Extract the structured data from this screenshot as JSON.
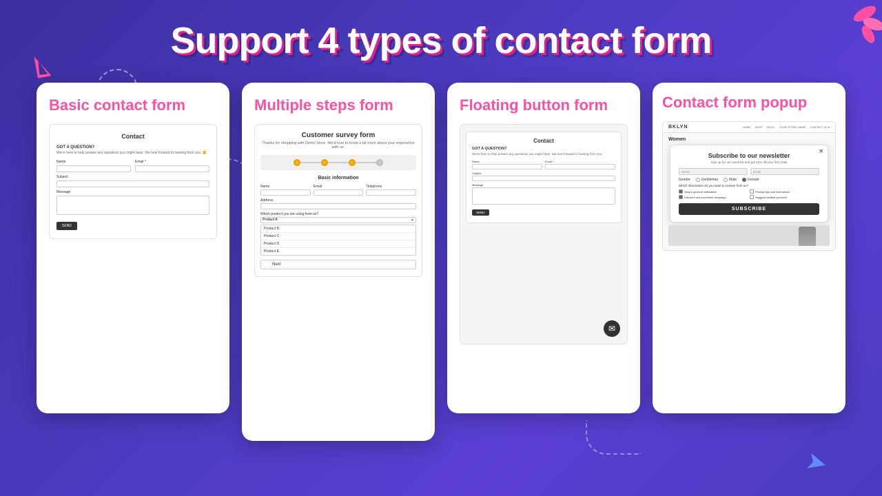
{
  "page": {
    "title": "Support 4 types of contact form",
    "background_gradient": "#3b2fa0"
  },
  "cards": [
    {
      "id": "basic",
      "title": "Basic contact form",
      "preview": {
        "heading": "Contact",
        "section_label": "GOT A QUESTION?",
        "section_text": "We're here to help answer any questions you might have. We look forward to hearing from you. 😊",
        "fields": [
          "Name",
          "Email *",
          "Subject",
          "Message"
        ],
        "button": "SEND"
      }
    },
    {
      "id": "multistep",
      "title": "Multiple steps form",
      "preview": {
        "heading": "Customer survey form",
        "subheading": "Thanks for shopping with Demo Store. We'd love to know a bit more about your experience with us.",
        "progress_steps": 4,
        "section": "Basic information",
        "fields": [
          "Name",
          "Email",
          "Telephone",
          "Address"
        ],
        "product_label": "Which product you are using from us?",
        "product_selected": "Product A",
        "product_options": [
          "Product A",
          "Product B",
          "Product C",
          "Product D",
          "Product E"
        ],
        "button": "Next"
      }
    },
    {
      "id": "floating",
      "title": "Floating button form",
      "preview": {
        "heading": "Contact",
        "section_label": "GOT A QUESTION?",
        "section_text": "We're here to help answer any questions you might have. We look forward to hearing from you.",
        "fields": [
          "Name",
          "Email *",
          "Subject",
          "Message"
        ],
        "button": "SEND",
        "float_icon": "✉"
      }
    },
    {
      "id": "popup",
      "title": "Contact form popup",
      "preview": {
        "site_logo": "BKLYN",
        "nav_items": [
          "HOME",
          "SHOP",
          "BLOG",
          "YOUR STORE NAME",
          "CONTACT US ▾"
        ],
        "page_section": "Women",
        "modal": {
          "title": "Subscribe to our newsletter",
          "subtitle": "Sign up for our email list and get 15% off your first order",
          "fields": [
            "Name",
            "Email"
          ],
          "gender_label": "Gender",
          "gender_options": [
            "Gentleman",
            "Male",
            "Female"
          ],
          "gender_selected": "Female",
          "info_label": "Which information do you want to receive from us?",
          "checkboxes": [
            {
              "label": "Shop's general notification",
              "checked": true
            },
            {
              "label": "Product tips and instructions",
              "checked": false
            },
            {
              "label": "Discount and promotion campaign",
              "checked": true
            },
            {
              "label": "Suggest suitable products",
              "checked": false
            }
          ],
          "button": "SUBSCRIBE"
        }
      }
    }
  ]
}
